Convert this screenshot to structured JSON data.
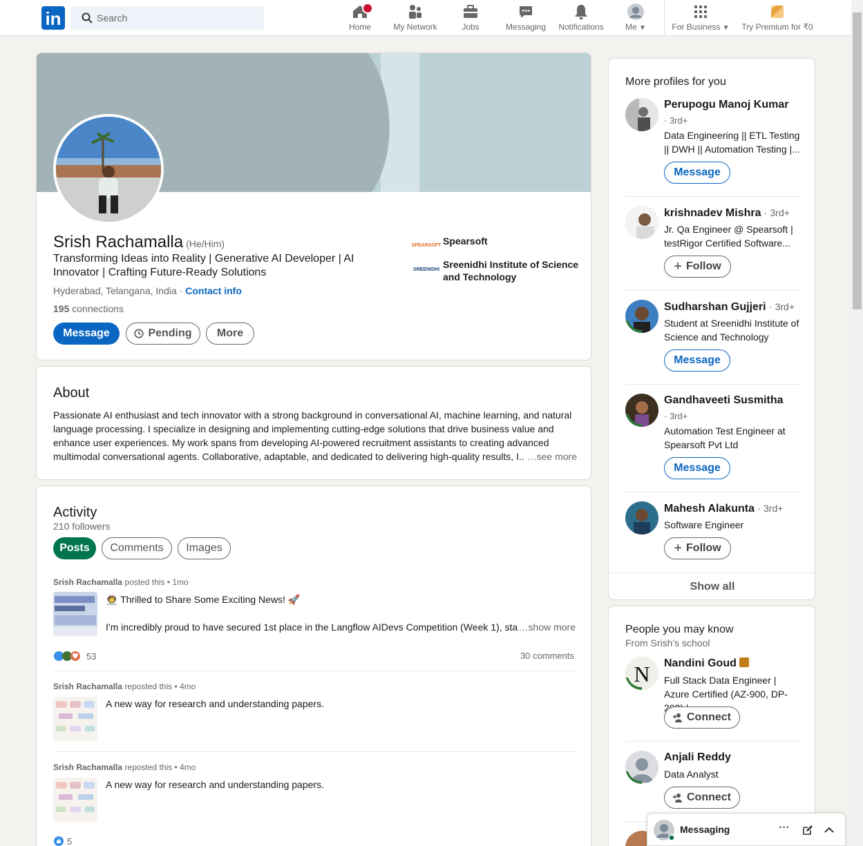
{
  "nav": {
    "logo": "in",
    "search_placeholder": "Search",
    "items": [
      {
        "label": "Home",
        "icon": "home-icon"
      },
      {
        "label": "My Network",
        "icon": "network-icon"
      },
      {
        "label": "Jobs",
        "icon": "jobs-icon"
      },
      {
        "label": "Messaging",
        "icon": "messaging-icon"
      },
      {
        "label": "Notifications",
        "icon": "bell-icon"
      },
      {
        "label": "Me",
        "icon": "avatar-icon"
      },
      {
        "label": "For Business",
        "icon": "grid-icon"
      },
      {
        "label": "Try Premium for ₹0",
        "icon": "premium-icon"
      }
    ]
  },
  "profile": {
    "name": "Srish Rachamalla",
    "pronouns": "(He/Him)",
    "headline": "Transforming Ideas into Reality | Generative AI Developer | AI Innovator | Crafting Future-Ready Solutions",
    "location": "Hyderabad, Telangana, India",
    "location_sep": " · ",
    "contact_info": "Contact info",
    "connections_count": "195",
    "connections_label": "connections",
    "buttons": {
      "message": "Message",
      "pending": "Pending",
      "more": "More"
    },
    "experience": [
      {
        "name": "Spearsoft",
        "logo_text": "SPEARSOFT"
      },
      {
        "name": "Sreenidhi Institute of Science and Technology",
        "logo_text": "SREENIDHI"
      }
    ]
  },
  "about": {
    "title": "About",
    "text": "Passionate AI enthusiast and tech innovator with a strong background in conversational AI, machine learning, and natural language processing. I specialize in designing and implementing cutting-edge solutions that drive business value and enhance user experiences. My work spans from developing AI-powered recruitment assistants to creating advanced multimodal conversational agents. Collaborative, adaptable, and dedicated to delivering high-quality results, I..",
    "see_more": "…see more"
  },
  "activity": {
    "title": "Activity",
    "followers": "210 followers",
    "tabs": [
      "Posts",
      "Comments",
      "Images"
    ],
    "posts": [
      {
        "author": "Srish Rachamalla",
        "action": "posted this • 1mo",
        "title": "🧑‍🚀 Thrilled to Share Some Exciting News! 🚀",
        "text": "I'm incredibly proud to have secured 1st place in the Langflow AIDevs Competition (Week 1), sta",
        "show_more": "…show more",
        "reactions": "53",
        "comments": "30 comments"
      },
      {
        "author": "Srish Rachamalla",
        "action": "reposted this • 4mo",
        "text": "A new way for research and understanding papers."
      },
      {
        "author": "Srish Rachamalla",
        "action": "reposted this • 4mo",
        "text": "A new way for research and understanding papers.",
        "reactions": "5"
      }
    ]
  },
  "more_profiles": {
    "title": "More profiles for you",
    "people": [
      {
        "name": "Perupogu Manoj Kumar",
        "degree": "· 3rd+",
        "desc": "Data Engineering || ETL Testing || DWH || Automation Testing |...",
        "action": "Message"
      },
      {
        "name": "krishnadev Mishra",
        "degree": "· 3rd+",
        "desc": "Jr. Qa Engineer @ Spearsoft | testRigor Certified Software...",
        "action": "Follow"
      },
      {
        "name": "Sudharshan Gujjeri",
        "degree": "· 3rd+",
        "desc": "Student at Sreenidhi Institute of Science and Technology",
        "action": "Message"
      },
      {
        "name": "Gandhaveeti Susmitha",
        "degree": "· 3rd+",
        "desc": "Automation Test Engineer at Spearsoft Pvt Ltd",
        "action": "Message"
      },
      {
        "name": "Mahesh Alakunta",
        "degree": "· 3rd+",
        "desc": "Software Engineer",
        "action": "Follow"
      }
    ],
    "show_all": "Show all"
  },
  "people_you_may_know": {
    "title": "People you may know",
    "subtitle": "From Srish's school",
    "people": [
      {
        "name": "Nandini Goud",
        "desc": "Full Stack Data Engineer | Azure Certified (AZ-900, DP-203) |...",
        "action": "Connect"
      },
      {
        "name": "Anjali Reddy",
        "desc": "Data Analyst",
        "action": "Connect"
      }
    ]
  },
  "messaging": {
    "label": "Messaging",
    "dots": "···"
  }
}
